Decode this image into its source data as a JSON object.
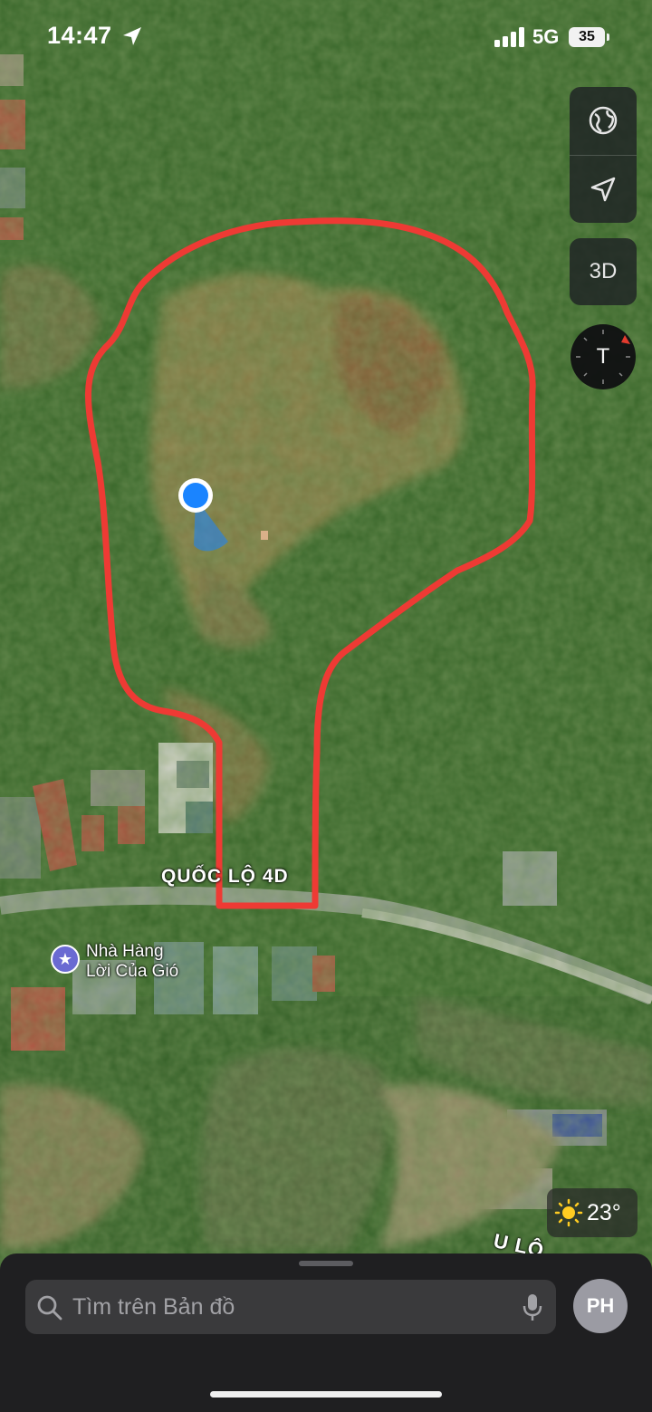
{
  "status_bar": {
    "time": "14:47",
    "network": "5G",
    "battery": "35"
  },
  "controls": {
    "globe_icon": "globe-icon",
    "location_icon": "location-arrow-icon",
    "three_d_label": "3D",
    "compass_label": "T"
  },
  "map": {
    "road_label": "QUỐC LỘ 4D",
    "road_label_2": "U LỘ",
    "poi": {
      "name_line1": "Nhà Hàng",
      "name_line2": "Lời Của Gió",
      "icon": "star-icon",
      "color": "#6a6ad2"
    },
    "boundary_color": "#ee3a34",
    "user_location_color": "#1a84ff"
  },
  "weather": {
    "temperature": "23°",
    "icon": "sun-icon"
  },
  "bottom_sheet": {
    "search_placeholder": "Tìm trên Bản đồ",
    "avatar_initials": "PH"
  }
}
